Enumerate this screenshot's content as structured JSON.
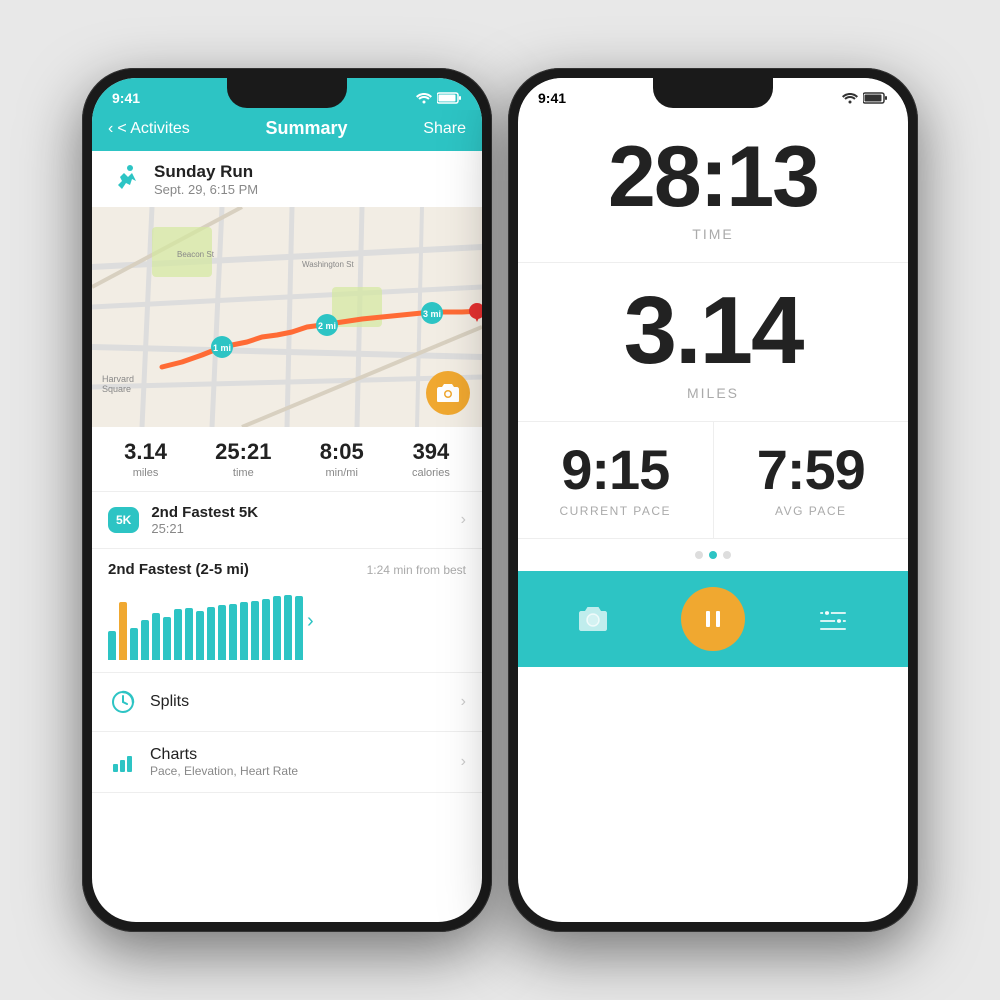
{
  "leftPhone": {
    "statusBar": {
      "time": "9:41",
      "icons": "wifi battery"
    },
    "nav": {
      "back": "< Activites",
      "title": "Summary",
      "share": "Share"
    },
    "activity": {
      "title": "Sunday Run",
      "date": "Sept. 29, 6:15 PM"
    },
    "stats": [
      {
        "value": "3.14",
        "label": "miles"
      },
      {
        "value": "25:21",
        "label": "time"
      },
      {
        "value": "8:05",
        "label": "min/mi"
      },
      {
        "value": "394",
        "label": "calories"
      }
    ],
    "achievement": {
      "badge": "5K",
      "title": "2nd Fastest 5K",
      "time": "25:21"
    },
    "chartSection": {
      "title": "2nd Fastest (2-5 mi)",
      "subtitle": "1:24 min from best",
      "bars": [
        40,
        80,
        45,
        55,
        65,
        60,
        70,
        72,
        68,
        74,
        76,
        78,
        80,
        82,
        85,
        88,
        90,
        88
      ]
    },
    "menu": [
      {
        "icon": "splits",
        "title": "Splits",
        "subtitle": ""
      },
      {
        "icon": "charts",
        "title": "Charts",
        "subtitle": "Pace, Elevation, Heart Rate"
      }
    ]
  },
  "rightPhone": {
    "statusBar": {
      "time": "9:41",
      "icons": "wifi battery"
    },
    "time": {
      "value": "28:13",
      "label": "TIME"
    },
    "miles": {
      "value": "3.14",
      "label": "MILES"
    },
    "currentPace": {
      "value": "9:15",
      "label": "CURRENT PACE"
    },
    "avgPace": {
      "value": "7:59",
      "label": "AVG PACE"
    },
    "dots": [
      false,
      true,
      false
    ],
    "bottomBar": {
      "camera": "📷",
      "pause": "⏸",
      "settings": "⚙"
    }
  }
}
